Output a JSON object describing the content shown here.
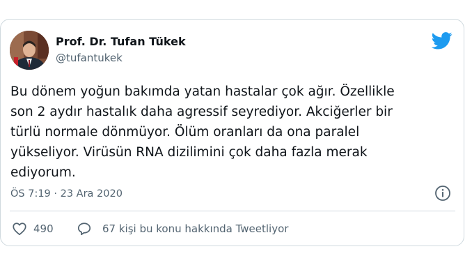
{
  "tweet": {
    "author_name": "Prof. Dr. Tufan Tükek",
    "author_handle": "@tufantukek",
    "text": "Bu dönem yoğun bakımda yatan hastalar çok ağır. Özellikle\nson 2 aydır hastalık daha agressif seyrediyor. Akciğerler bir\ntürlü normale dönmüyor. Ölüm oranları da ona paralel\nyükseliyor. Virüsün RNA dizilimini çok daha fazla merak\nediyorum.",
    "timestamp": "ÖS 7:19 · 23 Ara 2020",
    "like_count": "490",
    "reply_text": "67 kişi bu konu hakkında Tweetliyor"
  },
  "icons": {
    "brand": "twitter-bird-icon",
    "info": "info-icon",
    "like": "heart-icon",
    "reply": "speech-bubble-icon"
  },
  "colors": {
    "twitter_blue": "#1d9bf0",
    "text_primary": "#0f1419",
    "text_secondary": "#536471",
    "border": "#cfd9de"
  }
}
